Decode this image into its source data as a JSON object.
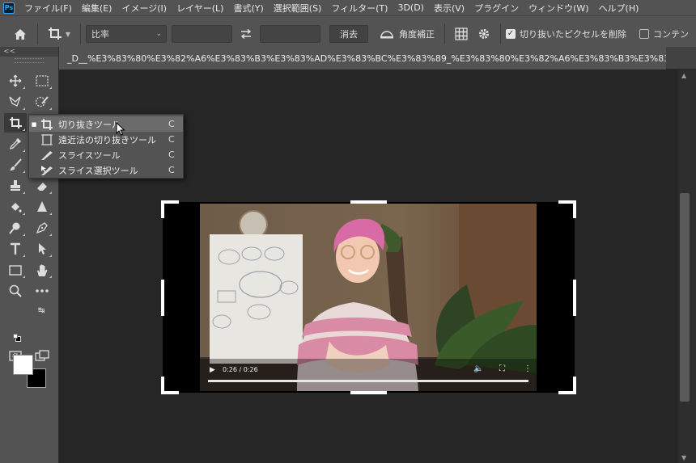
{
  "app": {
    "logo": "Ps"
  },
  "menubar": {
    "items": [
      "ファイル(F)",
      "編集(E)",
      "イメージ(I)",
      "レイヤー(L)",
      "書式(Y)",
      "選択範囲(S)",
      "フィルター(T)",
      "3D(D)",
      "表示(V)",
      "プラグイン",
      "ウィンドウ(W)",
      "ヘルプ(H)"
    ]
  },
  "options": {
    "ratio_select": "比率",
    "clear_button": "消去",
    "straighten_label": "角度補正",
    "delete_cropped_label": "切り抜いたピクセルを削除",
    "delete_cropped_checked": true,
    "content_aware_label": "コンテン",
    "content_aware_checked": false
  },
  "toolbar": {
    "collapse_glyph": "<<"
  },
  "document": {
    "tab_title": "_D__%E3%83%80%E3%82%A6%E3%83%B3%E3%83%AD%E3%83%BC%E3%83%89_%E3%83%80%E3%82%A6%E3%83%B3%E3%83%AD%E"
  },
  "flyout": {
    "items": [
      {
        "label": "切り抜きツール",
        "key": "C",
        "selected": true,
        "icon": "crop-icon"
      },
      {
        "label": "遠近法の切り抜きツール",
        "key": "C",
        "selected": false,
        "icon": "perspective-crop-icon"
      },
      {
        "label": "スライスツール",
        "key": "C",
        "selected": false,
        "icon": "slice-icon"
      },
      {
        "label": "スライス選択ツール",
        "key": "C",
        "selected": false,
        "icon": "slice-select-icon"
      }
    ]
  },
  "video": {
    "time": "0:26 / 0:26",
    "progress": 1.0
  },
  "colors": {
    "foreground": "#ffffff",
    "background": "#000000",
    "panel": "#535353",
    "workspace": "#262626",
    "accent": "#31a8ff"
  }
}
